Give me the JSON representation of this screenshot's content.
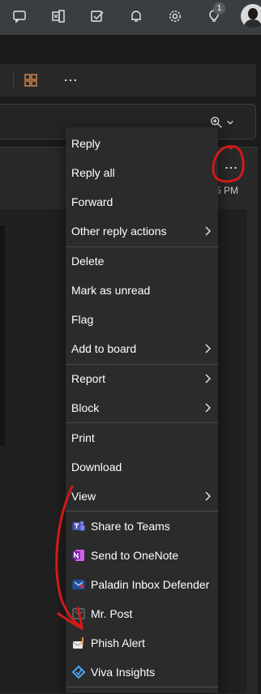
{
  "topbar": {
    "icons": [
      "feedback-icon",
      "office-apps-icon",
      "task-icon",
      "notifications-icon",
      "settings-icon",
      "tips-icon"
    ],
    "tips_badge": "1"
  },
  "toolbar": {
    "icons": [
      "apps-icon",
      "more-icon"
    ]
  },
  "search": {
    "icons": [
      "zoom-icon",
      "chevron-down-icon"
    ]
  },
  "message": {
    "time_fragment": "5 PM"
  },
  "menu": {
    "items": [
      {
        "label": "Reply"
      },
      {
        "label": "Reply all"
      },
      {
        "label": "Forward"
      },
      {
        "label": "Other reply actions",
        "submenu": true
      },
      {
        "label": "Delete"
      },
      {
        "label": "Mark as unread"
      },
      {
        "label": "Flag"
      },
      {
        "label": "Add to board",
        "submenu": true
      },
      {
        "label": "Report",
        "submenu": true
      },
      {
        "label": "Block",
        "submenu": true
      },
      {
        "label": "Print"
      },
      {
        "label": "Download"
      },
      {
        "label": "View",
        "submenu": true
      },
      {
        "label": "Share to Teams",
        "icon": "teams-icon"
      },
      {
        "label": "Send to OneNote",
        "icon": "onenote-icon"
      },
      {
        "label": "Paladin Inbox Defender",
        "icon": "paladin-icon"
      },
      {
        "label": "Mr. Post",
        "icon": "mr-post-icon"
      },
      {
        "label": "Phish Alert",
        "icon": "phish-alert-icon"
      },
      {
        "label": "Viva Insights",
        "icon": "viva-insights-icon"
      }
    ]
  },
  "colors": {
    "topbar_bg": "#3a3d41",
    "menu_bg": "#2b2b2b",
    "annotation_red": "#d11a1a",
    "apps_icon_orange": "#d98a4a"
  }
}
